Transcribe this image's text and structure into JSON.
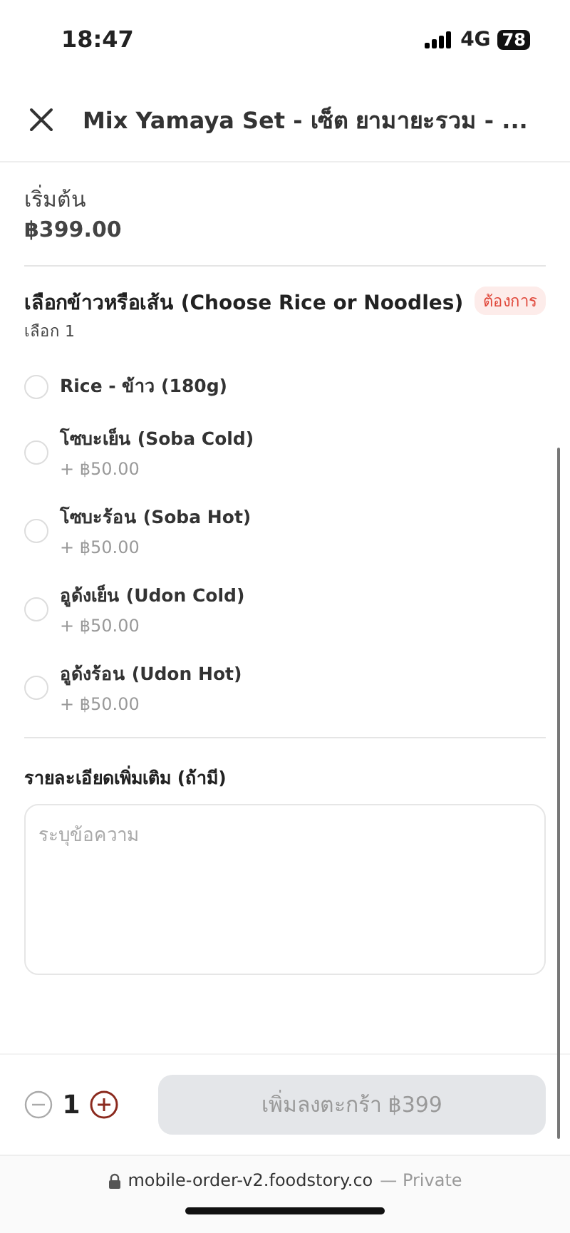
{
  "status_bar": {
    "time": "18:47",
    "network": "4G",
    "battery": "78"
  },
  "header": {
    "title": "Mix Yamaya Set - เซ็ต ยามายะรวม - ..."
  },
  "price": {
    "label": "เริ่มต้น",
    "value": "฿399.00"
  },
  "option_group": {
    "title": "เลือกข้าวหรือเส้น (Choose Rice or Noodles)",
    "badge": "ต้องการ",
    "hint": "เลือก 1",
    "options": [
      {
        "label": "Rice - ข้าว (180g)",
        "selected": false
      },
      {
        "label": "โซบะเย็น (Soba Cold)",
        "extra": "+ ฿50.00",
        "selected": false
      },
      {
        "label": "โซบะร้อน (Soba Hot)",
        "extra": "+ ฿50.00",
        "selected": false
      },
      {
        "label": "อูด้งเย็น (Udon Cold)",
        "extra": "+ ฿50.00",
        "selected": false
      },
      {
        "label": "อูด้งร้อน (Udon Hot)",
        "extra": "+ ฿50.00",
        "selected": false
      }
    ]
  },
  "note": {
    "label": "รายละเอียดเพิ่มเติม (ถ้ามี)",
    "placeholder": "ระบุข้อความ"
  },
  "footer": {
    "quantity": "1",
    "add_button": {
      "label": "เพิ่มลงตะกร้า ฿399",
      "disabled": true
    }
  },
  "browser_bar": {
    "url": "mobile-order-v2.foodstory.co",
    "mode": "— Private"
  }
}
